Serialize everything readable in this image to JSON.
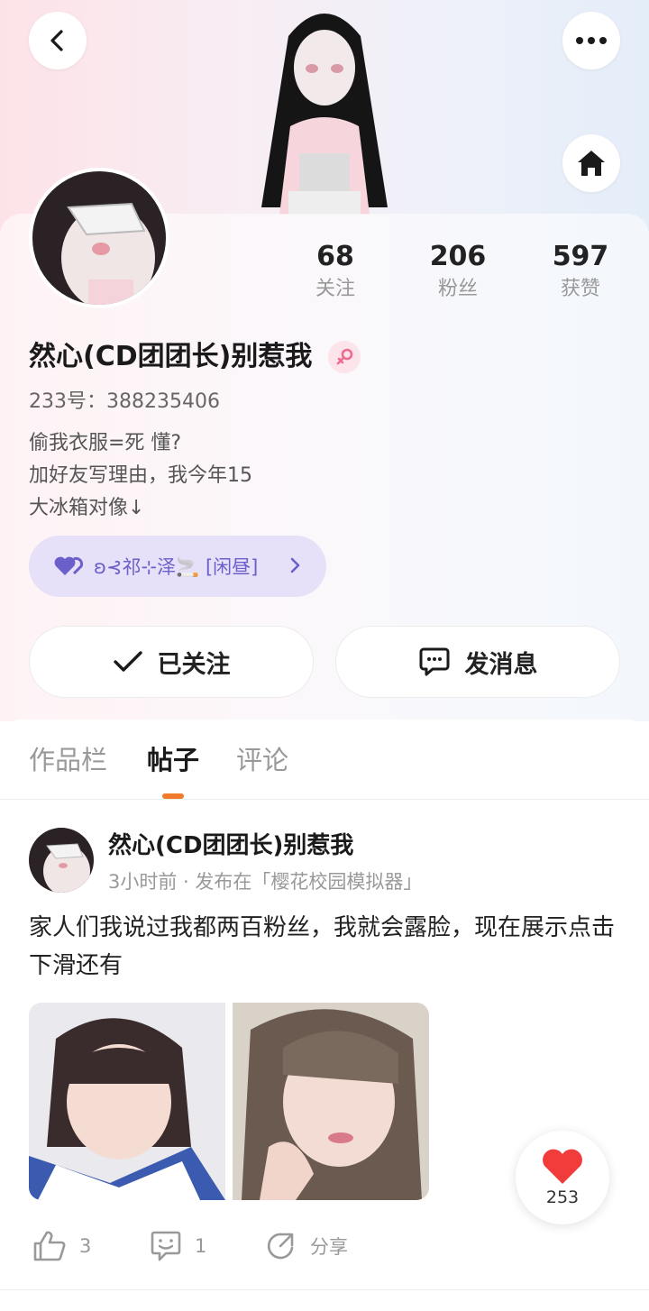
{
  "header": {
    "back_icon": "chevron-left-icon",
    "more_icon": "more-horizontal-icon",
    "home_icon": "home-icon"
  },
  "profile": {
    "name": "然心(CD团团长)别惹我",
    "gender_icon": "female-icon",
    "uid": "233号：388235406",
    "bio_lines": [
      "偷我衣服=死 懂?",
      "加好友写理由，我今年15",
      "大冰箱对像↓"
    ],
    "stats": [
      {
        "value": "68",
        "label": "关注"
      },
      {
        "value": "206",
        "label": "粉丝"
      },
      {
        "value": "597",
        "label": "获赞"
      }
    ],
    "fan_badge": "ʚ⊰祁⊹泽🚬 [闲昼]",
    "follow_label": "已关注",
    "message_label": "发消息"
  },
  "tabs": [
    {
      "label": "作品栏",
      "active": false
    },
    {
      "label": "帖子",
      "active": true
    },
    {
      "label": "评论",
      "active": false
    }
  ],
  "post": {
    "author": "然心(CD团团长)别惹我",
    "meta": "3小时前 · 发布在「樱花校园模拟器」",
    "text": "家人们我说过我都两百粉丝，我就会露脸，现在展示点击下滑还有",
    "like_count": "3",
    "comment_count": "1",
    "share_label": "分享",
    "heart_count": "253"
  },
  "colors": {
    "accent": "#f07a2c",
    "badge_bg": "#e6e1f8",
    "badge_text": "#6b5fc9",
    "heart": "#f23b3b"
  }
}
